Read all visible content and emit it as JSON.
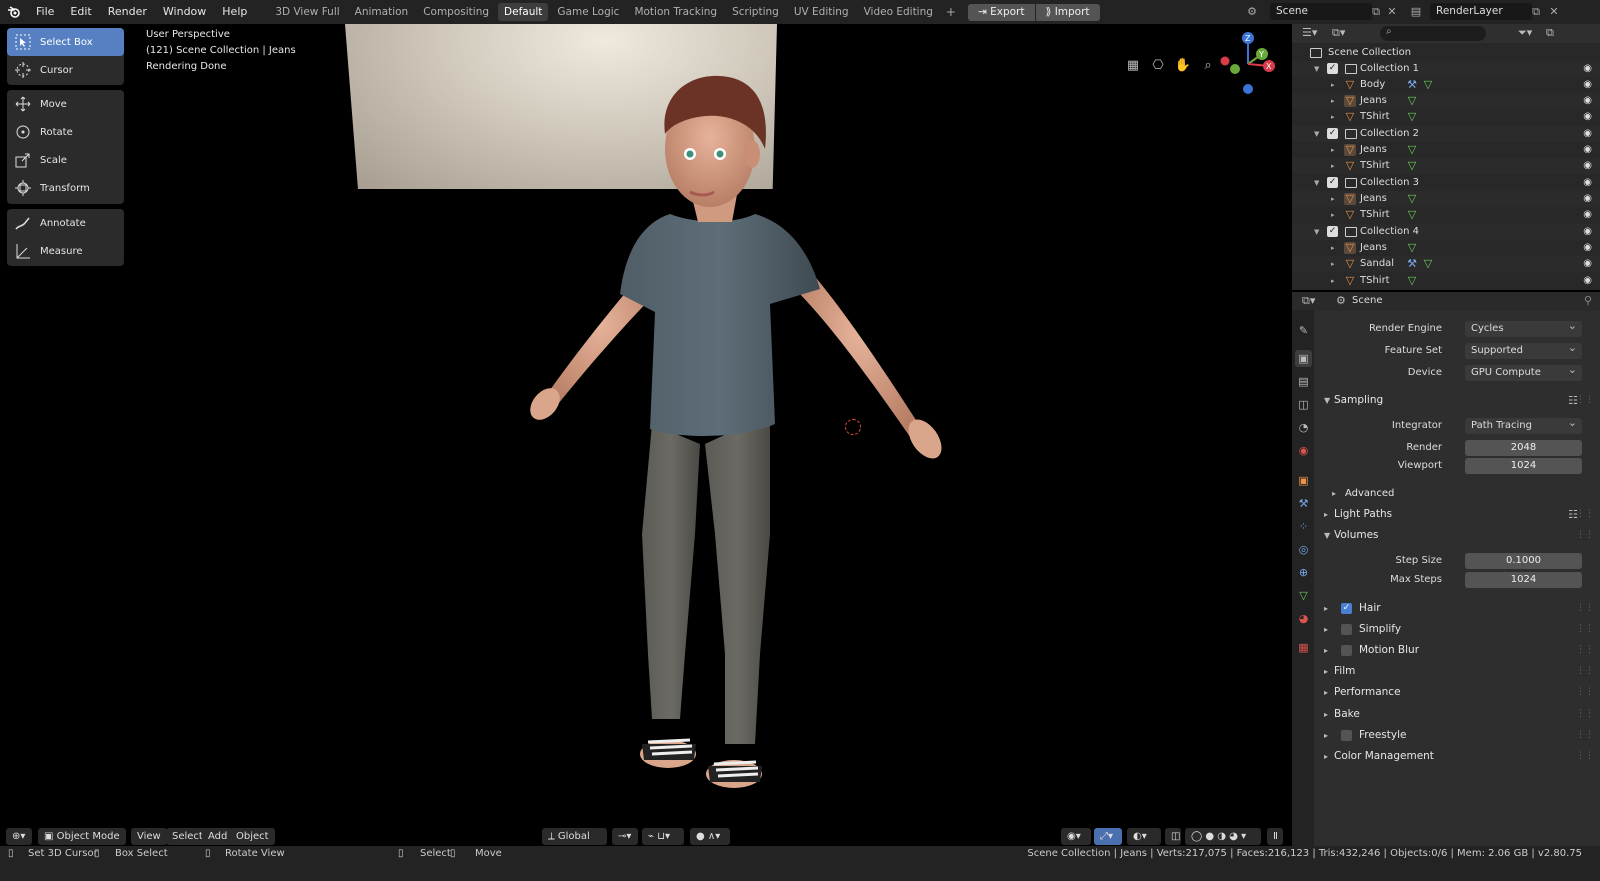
{
  "topbar": {
    "menus": [
      "File",
      "Edit",
      "Render",
      "Window",
      "Help"
    ],
    "workspaces": [
      "3D View Full",
      "Animation",
      "Compositing",
      "Default",
      "Game Logic",
      "Motion Tracking",
      "Scripting",
      "UV Editing",
      "Video Editing"
    ],
    "active_workspace": "Default",
    "add_workspace": "+",
    "export_label": "Export",
    "import_label": "Import",
    "scene_name": "Scene",
    "view_layer": "RenderLayer"
  },
  "viewport": {
    "perspective": "User Perspective",
    "collection_info": "(121) Scene Collection | Jeans",
    "render_status": "Rendering Done"
  },
  "toolbar": {
    "select_box": "Select Box",
    "cursor": "Cursor",
    "move": "Move",
    "rotate": "Rotate",
    "scale": "Scale",
    "transform": "Transform",
    "annotate": "Annotate",
    "measure": "Measure"
  },
  "vp_header": {
    "mode": "Object Mode",
    "view": "View",
    "select": "Select",
    "add": "Add",
    "object": "Object",
    "orientation": "Global"
  },
  "gizmo": {
    "z": "Z",
    "y": "Y",
    "x": "X"
  },
  "outliner": {
    "root": "Scene Collection",
    "rows": [
      {
        "name": "Collection 1",
        "type": "collection"
      },
      {
        "name": "Body",
        "type": "object"
      },
      {
        "name": "Jeans",
        "type": "object"
      },
      {
        "name": "TShirt",
        "type": "object"
      },
      {
        "name": "Collection 2",
        "type": "collection"
      },
      {
        "name": "Jeans",
        "type": "object"
      },
      {
        "name": "TShirt",
        "type": "object"
      },
      {
        "name": "Collection 3",
        "type": "collection"
      },
      {
        "name": "Jeans",
        "type": "object"
      },
      {
        "name": "TShirt",
        "type": "object"
      },
      {
        "name": "Collection 4",
        "type": "collection"
      },
      {
        "name": "Jeans",
        "type": "object"
      },
      {
        "name": "Sandal",
        "type": "object"
      },
      {
        "name": "TShirt",
        "type": "object"
      }
    ]
  },
  "properties": {
    "context": "Scene",
    "render_engine_label": "Render Engine",
    "render_engine": "Cycles",
    "feature_set_label": "Feature Set",
    "feature_set": "Supported",
    "device_label": "Device",
    "device": "GPU Compute",
    "sampling": "Sampling",
    "integrator_label": "Integrator",
    "integrator": "Path Tracing",
    "render_label": "Render",
    "render_samples": "2048",
    "viewport_label": "Viewport",
    "viewport_samples": "1024",
    "advanced": "Advanced",
    "light_paths": "Light Paths",
    "volumes": "Volumes",
    "step_size_label": "Step Size",
    "step_size": "0.1000",
    "max_steps_label": "Max Steps",
    "max_steps": "1024",
    "hair": "Hair",
    "simplify": "Simplify",
    "motion_blur": "Motion Blur",
    "film": "Film",
    "performance": "Performance",
    "bake": "Bake",
    "freestyle": "Freestyle",
    "color_management": "Color Management"
  },
  "statusbar": {
    "set_cursor": "Set 3D Cursor",
    "box_select": "Box Select",
    "rotate_view": "Rotate View",
    "select": "Select",
    "move": "Move",
    "stats": "Scene Collection | Jeans | Verts:217,075 | Faces:216,123 | Tris:432,246 | Objects:0/6 | Mem: 2.06 GB | v2.80.75"
  },
  "colors": {
    "accent": "#5680c2",
    "object_orange": "#e9944a",
    "mesh_green": "#6cce5c",
    "modifier_blue": "#7aa6ea"
  }
}
